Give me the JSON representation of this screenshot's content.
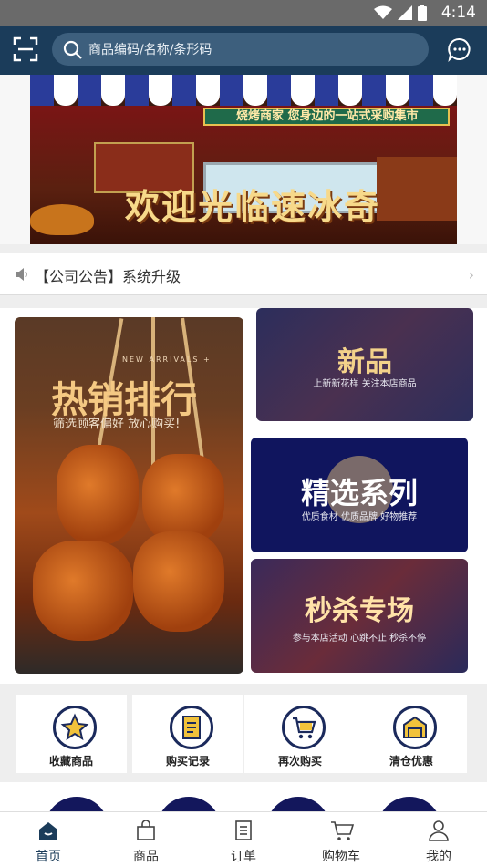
{
  "status_bar": {
    "time": "4:14"
  },
  "search": {
    "placeholder": "商品编码/名称/条形码"
  },
  "banner": {
    "sign": "烧烤商家 您身边的一站式采购集市",
    "title": "欢迎光临速冰奇"
  },
  "notice": {
    "text": "【公司公告】系统升级"
  },
  "features": {
    "hot": {
      "tag": "NEW ARRIVALS +",
      "title": "热销排行",
      "subtitle": "筛选顾客偏好 放心购买!"
    },
    "new": {
      "title": "新品",
      "subtitle": "上新新花样 关注本店商品"
    },
    "selected": {
      "title": "精选系列",
      "subtitle": "优质食材 优质品牌 好物推荐"
    },
    "seckill": {
      "title": "秒杀专场",
      "subtitle": "参与本店活动 心跳不止 秒杀不停"
    }
  },
  "quick_links": [
    {
      "label": "收藏商品",
      "icon": "star-icon"
    },
    {
      "label": "购买记录",
      "icon": "receipt-icon"
    },
    {
      "label": "再次购买",
      "icon": "cart-plus-icon"
    },
    {
      "label": "清仓优惠",
      "icon": "warehouse-icon"
    }
  ],
  "tabs": [
    {
      "label": "首页",
      "icon": "home-icon",
      "active": true
    },
    {
      "label": "商品",
      "icon": "bag-icon"
    },
    {
      "label": "订单",
      "icon": "order-icon"
    },
    {
      "label": "购物车",
      "icon": "cart-icon"
    },
    {
      "label": "我的",
      "icon": "user-icon"
    }
  ],
  "colors": {
    "primary": "#1b3c5a",
    "accent_navy": "#13175c"
  }
}
